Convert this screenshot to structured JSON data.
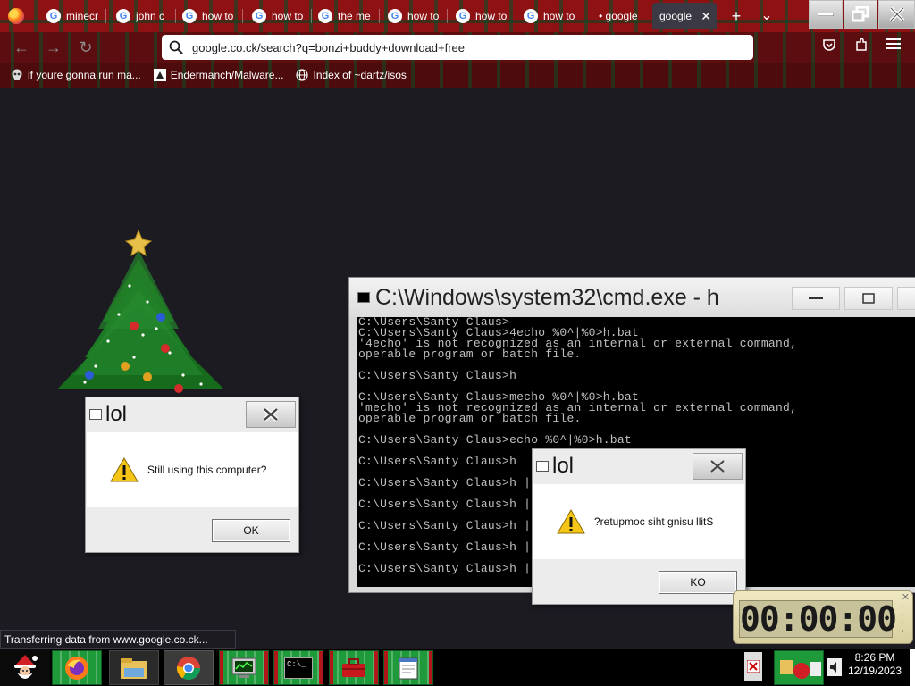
{
  "browser": {
    "tabs": [
      {
        "label": "minecr",
        "favicon": "google-icon"
      },
      {
        "label": "john c",
        "favicon": "google-icon"
      },
      {
        "label": "how to",
        "favicon": "google-icon"
      },
      {
        "label": "how to",
        "favicon": "google-icon"
      },
      {
        "label": "the me",
        "favicon": "google-icon"
      },
      {
        "label": "how to",
        "favicon": "google-icon"
      },
      {
        "label": "how to",
        "favicon": "google-icon"
      },
      {
        "label": "how to",
        "favicon": "google-icon"
      },
      {
        "label": "• google",
        "favicon": "none"
      },
      {
        "label": "google.",
        "favicon": "none",
        "active": true
      }
    ],
    "new_tab": "+",
    "tab_list": "⌄",
    "url": "google.co.ck/search?q=bonzi+buddy+download+free",
    "bookmarks": [
      {
        "label": "if youre gonna run ma...",
        "icon": "skull-icon"
      },
      {
        "label": "Endermanch/Malware...",
        "icon": "github-icon"
      },
      {
        "label": "Index of ~dartz/isos",
        "icon": "globe-icon"
      }
    ],
    "status_text": "Transferring data from www.google.co.ck..."
  },
  "cmd": {
    "title": "C:\\Windows\\system32\\cmd.exe - h",
    "lines": [
      "C:\\Users\\Santy Claus>",
      "C:\\Users\\Santy Claus>4echo %0^|%0>h.bat",
      "'4echo' is not recognized as an internal or external command,",
      "operable program or batch file.",
      "",
      "C:\\Users\\Santy Claus>h",
      "",
      "C:\\Users\\Santy Claus>mecho %0^|%0>h.bat",
      "'mecho' is not recognized as an internal or external command,",
      "operable program or batch file.",
      "",
      "C:\\Users\\Santy Claus>echo %0^|%0>h.bat",
      "",
      "C:\\Users\\Santy Claus>h",
      "",
      "C:\\Users\\Santy Claus>h |",
      "",
      "C:\\Users\\Santy Claus>h |",
      "",
      "C:\\Users\\Santy Claus>h |",
      "",
      "C:\\Users\\Santy Claus>h |",
      "",
      "C:\\Users\\Santy Claus>h |"
    ]
  },
  "dialog1": {
    "title": "lol",
    "message": "Still using this computer?",
    "button": "OK"
  },
  "dialog2": {
    "title": "lol",
    "message": "?retupmoc siht gnisu llitS",
    "button": "KO"
  },
  "timer": {
    "display": "00:00:00"
  },
  "taskbar": {
    "apps": [
      "santa-start-icon",
      "firefox-icon",
      "file-explorer-icon",
      "chrome-icon",
      "task-manager-icon",
      "cmd-icon",
      "toolbox-icon",
      "notepad-icon"
    ],
    "cmd_icon_text": "C:\\_",
    "clock_time": "8:26 PM",
    "clock_date": "12/19/2023"
  },
  "colors": {
    "tartan_red": "#8e1214",
    "tartan_green": "#1f9a3a",
    "desktop_bg": "#1c1b22"
  }
}
